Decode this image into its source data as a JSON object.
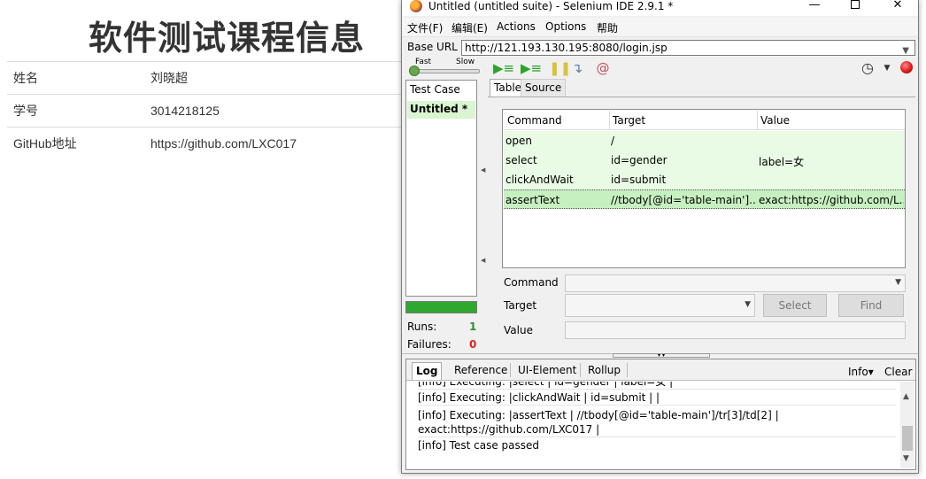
{
  "background_page": {
    "title": "软件测试课程信息",
    "rows": [
      {
        "label": "姓名",
        "value": "刘晓超"
      },
      {
        "label": "学号",
        "value": "3014218125"
      },
      {
        "label": "GitHub地址",
        "value": "https://github.com/LXC017"
      }
    ]
  },
  "ide": {
    "window_title": "Untitled (untitled suite) - Selenium IDE 2.9.1 *",
    "window_controls": {
      "minimize": "—",
      "close": "✕"
    },
    "menu": [
      "文件(F)",
      "编辑(E)",
      "Actions",
      "Options",
      "帮助"
    ],
    "base_url_label": "Base URL",
    "base_url_value": "http://121.193.130.195:8080/login.jsp",
    "speed": {
      "fast": "Fast",
      "slow": "Slow"
    },
    "icons": [
      "play-all-icon",
      "play-icon",
      "pause-icon",
      "step-icon",
      "rollup-icon",
      "clock-icon",
      "record-icon"
    ],
    "testcase_header": "Test Case",
    "testcase_item": "Untitled *",
    "runs_label": "Runs:",
    "runs_value": "1",
    "failures_label": "Failures:",
    "failures_value": "0",
    "tabs": {
      "table": "Table",
      "source": "Source"
    },
    "columns": {
      "command": "Command",
      "target": "Target",
      "value": "Value"
    },
    "commands": [
      {
        "command": "open",
        "target": "/",
        "value": ""
      },
      {
        "command": "select",
        "target": "id=gender",
        "value": "label=女"
      },
      {
        "command": "clickAndWait",
        "target": "id=submit",
        "value": ""
      },
      {
        "command": "assertText",
        "target": "//tbody[@id='table-main']...",
        "value": "exact:https://github.com/L..."
      }
    ],
    "fields": {
      "command_label": "Command",
      "target_label": "Target",
      "value_label": "Value",
      "select_button": "Select",
      "find_button": "Find"
    },
    "log": {
      "tabs": [
        "Log",
        "Reference",
        "UI-Element",
        "Rollup"
      ],
      "level": "Info▾",
      "clear": "Clear",
      "lines": [
        "[info] Executing: |select | id=gender | label=女 |",
        "[info] Executing: |clickAndWait | id=submit | |",
        "[info] Executing: |assertText | //tbody[@id='table-main']/tr[3]/td[2] |",
        "exact:https://github.com/LXC017 |",
        "[info] Test case passed"
      ]
    },
    "colors": {
      "pass_row": "#e9fbe4",
      "selected_row": "#c7f0c0",
      "progress": "#2fa82f",
      "failures": "#dd2222"
    }
  }
}
